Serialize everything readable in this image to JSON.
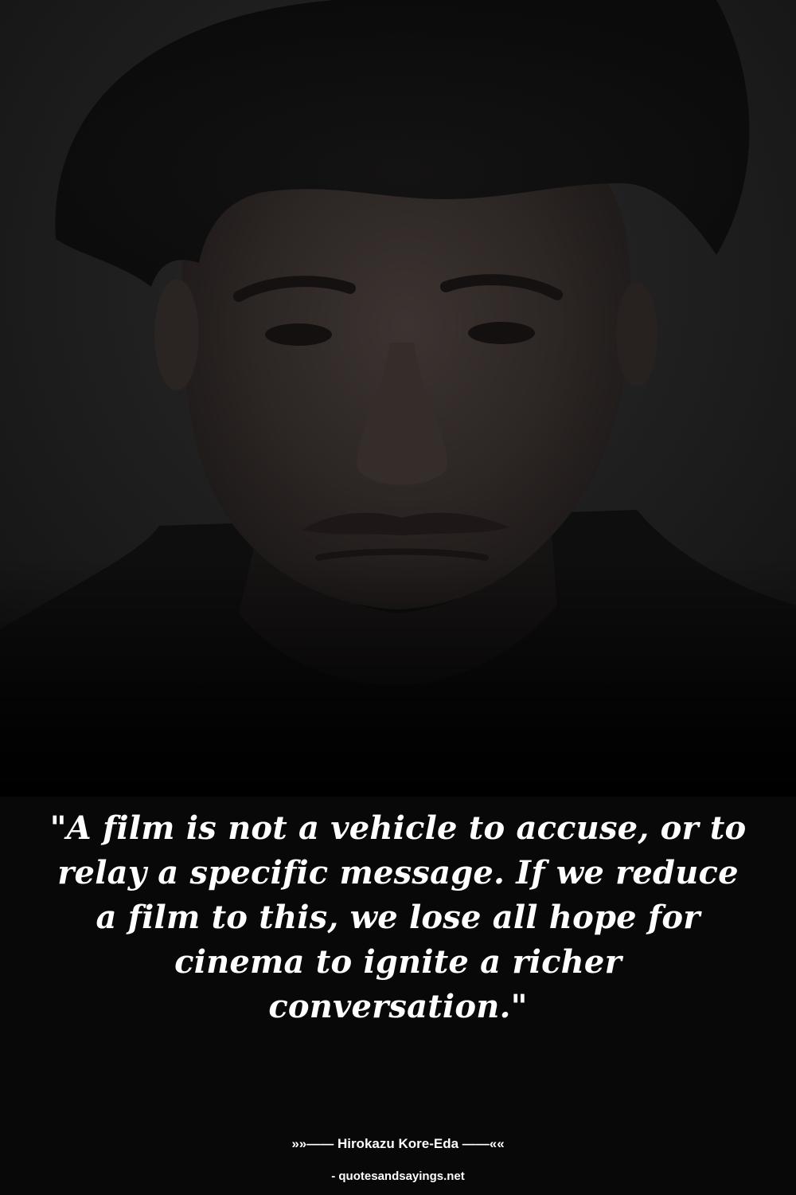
{
  "quote": {
    "text": "\"A film is not a vehicle to accuse, or to relay a specific message. If we reduce a film to this, we lose all hope for cinema to ignite a richer conversation.\""
  },
  "attribution": {
    "author_line": "»»—— Hirokazu Kore-Eda ——««",
    "source_line": "- quotesandsayings.net"
  },
  "colors": {
    "background": "#080808",
    "text": "#ffffff"
  }
}
